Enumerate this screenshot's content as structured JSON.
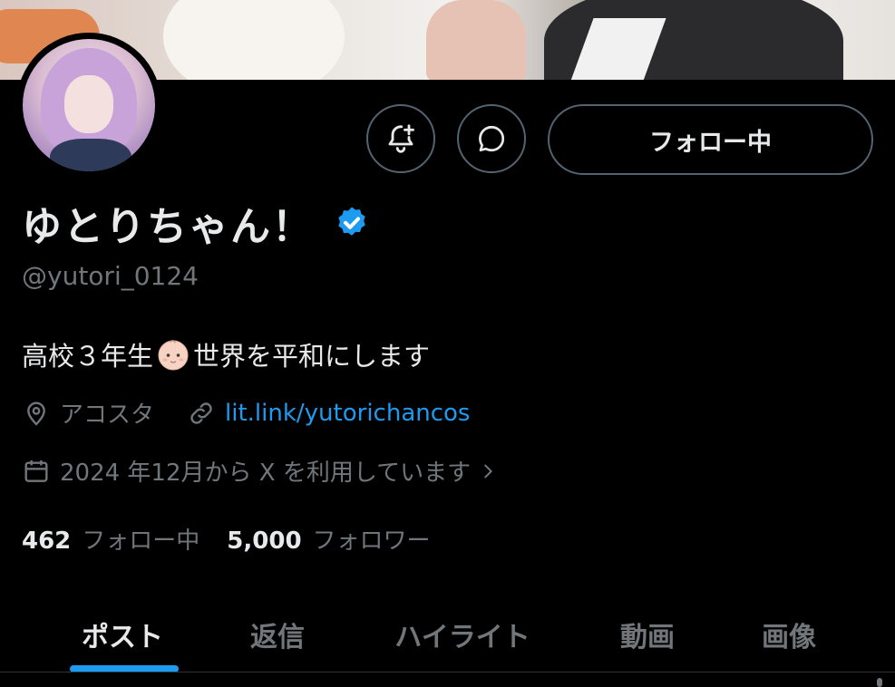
{
  "profile": {
    "display_name": "ゆとりちゃん！",
    "handle": "@yutori_0124",
    "bio_before": "高校３年生",
    "bio_emoji": "baby-emoji",
    "bio_after": "世界を平和にします",
    "location": "アコスタ",
    "link": "lit.link/yutorichancos",
    "joined": "2024 年12月から X を利用しています",
    "following_count": "462",
    "following_label": "フォロー中",
    "followers_count": "5,000",
    "followers_label": "フォロワー",
    "verified": true
  },
  "actions": {
    "notify_icon": "bell-plus-icon",
    "message_icon": "message-icon",
    "follow_label": "フォロー中"
  },
  "tabs": [
    {
      "label": "ポスト",
      "active": true
    },
    {
      "label": "返信",
      "active": false
    },
    {
      "label": "ハイライト",
      "active": false
    },
    {
      "label": "動画",
      "active": false
    },
    {
      "label": "画像",
      "active": false
    }
  ],
  "colors": {
    "background": "#000000",
    "text": "#e7e9ea",
    "muted": "#71767b",
    "accent": "#1d9bf0",
    "border": "#536471"
  }
}
